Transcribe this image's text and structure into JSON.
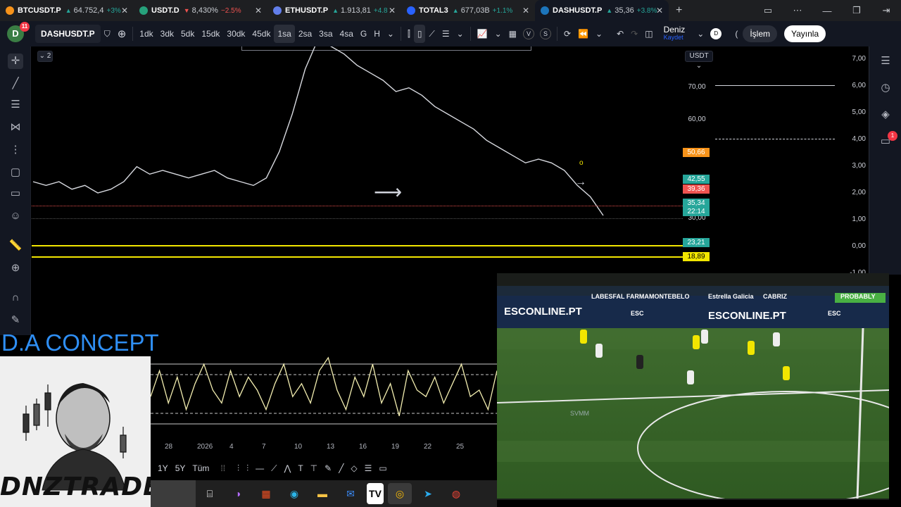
{
  "tabs": [
    {
      "symbol": "BTCUSDT.P",
      "price": "64.752,4",
      "change": "+3%",
      "dir": "up",
      "color": "#f7931a"
    },
    {
      "symbol": "USDT.D",
      "price": "8,430%",
      "change": "−2.5%",
      "dir": "down",
      "color": "#26a17b"
    },
    {
      "symbol": "ETHUSDT.P",
      "price": "1.913,81",
      "change": "+4.8",
      "dir": "up",
      "color": "#627eea"
    },
    {
      "symbol": "TOTAL3",
      "price": "677,03B",
      "change": "+1.1%",
      "dir": "up",
      "color": "#2962ff"
    },
    {
      "symbol": "DASHUSDT.P",
      "price": "35,36",
      "change": "+3.8%",
      "dir": "up",
      "color": "#1c75bc"
    }
  ],
  "toolbar": {
    "avatar_letter": "D",
    "notifications": "11",
    "symbol": "DASHUSDT.P",
    "intervals": [
      "1dk",
      "3dk",
      "5dk",
      "15dk",
      "30dk",
      "45dk",
      "1sa",
      "2sa",
      "3sa",
      "4sa",
      "G",
      "H"
    ],
    "selected_interval": "1sa",
    "user_name": "Deniz",
    "save_label": "Kaydet",
    "user_badge": "D",
    "trade_label": "İşlem",
    "publish_label": "Yayınla",
    "v_label": "V",
    "s_label": "S"
  },
  "chart": {
    "currency": "USDT",
    "collapse_label": "2",
    "price_levels": [
      "70,00",
      "60,00",
      "30,00"
    ],
    "price_tags": [
      {
        "value": "50,66",
        "color": "#f7931a"
      },
      {
        "value": "42,55",
        "color": "#26a69a"
      },
      {
        "value": "39,36",
        "color": "#ef5350"
      },
      {
        "value": "35,34",
        "color": "#26a69a"
      },
      {
        "value": "22:14",
        "color": "#26a69a"
      },
      {
        "value": "23,21",
        "color": "#26a69a"
      },
      {
        "value": "18,89",
        "color": "#f2e600"
      }
    ],
    "overlay_scale": [
      "7,00",
      "6,00",
      "5,00",
      "4,00",
      "3,00",
      "2,00",
      "1,00",
      "0,00",
      "-1,00"
    ],
    "alert_count": "1"
  },
  "chart_data": {
    "type": "line",
    "series": [
      {
        "values": [
          44,
          43,
          44,
          42,
          43,
          41,
          42,
          44,
          48,
          46,
          47,
          46,
          45,
          46,
          47,
          45,
          44,
          43,
          45,
          52,
          62,
          74,
          82,
          80,
          78,
          75,
          73,
          71,
          68,
          69,
          67,
          64,
          62,
          60,
          58,
          55,
          53,
          51,
          49,
          50,
          49,
          47,
          43,
          40,
          35
        ]
      }
    ],
    "ylim": [
      20,
      80
    ]
  },
  "indicator": {
    "values": [
      0.4,
      0.8,
      0.3,
      0.7,
      0.2,
      0.6,
      0.9,
      0.5,
      0.3,
      0.8,
      0.4,
      0.7,
      0.5,
      0.2,
      0.6,
      0.9,
      0.4,
      0.6,
      0.3,
      0.8,
      1.0,
      0.5,
      0.2,
      0.7,
      0.4,
      0.9,
      0.3,
      0.6,
      0.1,
      0.8,
      0.5,
      0.4,
      0.7,
      0.3,
      0.6,
      0.9,
      0.4,
      0.5,
      0.2,
      0.8
    ]
  },
  "date_axis": [
    "28",
    "2026",
    "4",
    "7",
    "10",
    "13",
    "16",
    "19",
    "22",
    "25"
  ],
  "bottom_tools": {
    "ranges": [
      "1Y",
      "5Y",
      "Tüm"
    ]
  },
  "brand": {
    "title": "D.A CONCEPT",
    "name": "DNZTRADE"
  },
  "video": {
    "ads": [
      "LABESFAL FARMA",
      "MONTEBELO",
      "Estrella Galicia",
      "CABRIZ",
      "ESCONLINE.PT",
      "ESCONLINE.PT",
      "ESC",
      "ESC"
    ],
    "sponsor": "PROBABLY",
    "watermark": "SVMM"
  }
}
